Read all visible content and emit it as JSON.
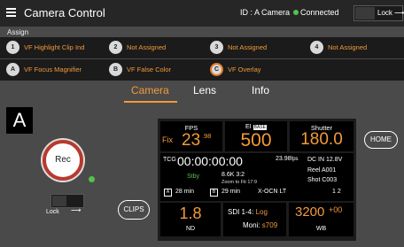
{
  "header": {
    "title": "Camera Control",
    "camera_id": "ID : A Camera",
    "connection": "Connected",
    "lock_label": "Lock"
  },
  "assign": {
    "label": "Assign",
    "buttons": [
      {
        "id": "1",
        "label": "VF Highlight Clip Ind"
      },
      {
        "id": "2",
        "label": "Not Assigned"
      },
      {
        "id": "3",
        "label": "Not Assigned"
      },
      {
        "id": "4",
        "label": "Not Assigned"
      },
      {
        "id": "A",
        "label": "VF Focus Magnifier"
      },
      {
        "id": "B",
        "label": "VF False Color"
      },
      {
        "id": "C",
        "label": "VF Overlay"
      }
    ]
  },
  "tabs": [
    {
      "label": "Camera",
      "active": true
    },
    {
      "label": "Lens",
      "active": false
    },
    {
      "label": "Info",
      "active": false
    }
  ],
  "camera_letter": "A",
  "rec": {
    "label": "Rec",
    "lock_label": "Lock"
  },
  "clips_label": "CLIPS",
  "home_label": "HOME",
  "status": {
    "fps": {
      "label": "FPS",
      "fix": "Fix",
      "value": "23",
      "decimal": ".98"
    },
    "ei": {
      "label": "EI",
      "badge": "BASE",
      "value": "500"
    },
    "shutter": {
      "label": "Shutter",
      "value": "180.0"
    },
    "timecode": {
      "label": "TCG",
      "value": "00:00:00:00",
      "rate": "23.98",
      "rate_unit": "fps"
    },
    "dc_in": "DC IN  12.8V",
    "rec_state": "Stby",
    "resolution": "8.6K 3:2",
    "zoom": "Zoom to Fit 17:9",
    "reel": {
      "label": "Reel",
      "value": "A001"
    },
    "shot": {
      "label": "Shot",
      "value": "C003"
    },
    "media_a": {
      "icon": "A",
      "remaining": "28 min"
    },
    "media_b": {
      "icon": "B",
      "remaining": "29 min"
    },
    "codec": "X-OCN LT",
    "page": "1 2",
    "iris": {
      "value": "1.8",
      "label": "ND"
    },
    "sdi": {
      "label1": "SDI 1-4:",
      "value1": "Log",
      "label2": "Moni:",
      "value2": "s709"
    },
    "wb": {
      "value": "3200",
      "tint": "+00",
      "label": "WB"
    }
  },
  "colors": {
    "accent": "#f39a3a",
    "connected": "#53c14a",
    "rec_ring": "#b73a2e"
  }
}
